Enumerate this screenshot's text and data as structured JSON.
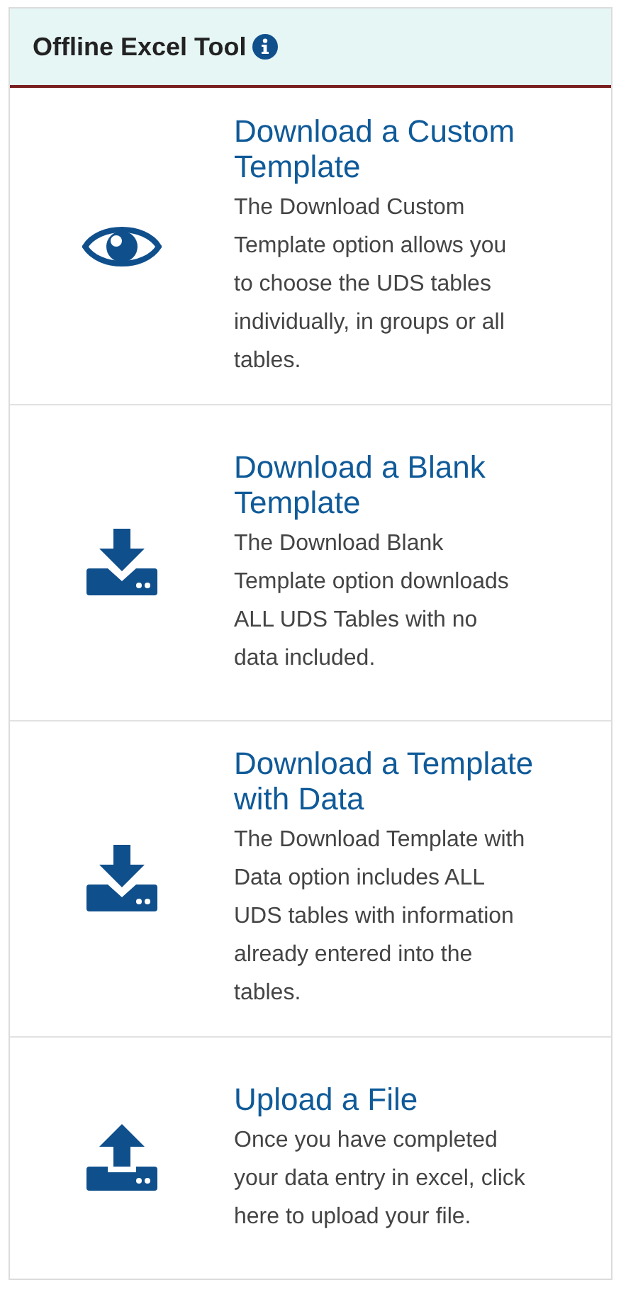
{
  "panel": {
    "title": "Offline Excel Tool"
  },
  "options": [
    {
      "kind": "eye",
      "title": "Download a Custom Template",
      "description": "The Download Custom Template option allows you to choose the UDS tables individually, in groups or all tables."
    },
    {
      "kind": "download",
      "title": "Download a Blank Template",
      "description": "The Download Blank Template option downloads ALL UDS Tables with no data included."
    },
    {
      "kind": "download",
      "title": "Download a Template with Data",
      "description": "The Download Template with Data option includes ALL UDS tables with information already entered into the tables."
    },
    {
      "kind": "upload",
      "title": "Upload a File",
      "description": "Once you have completed your data entry in excel, click here to upload your file."
    }
  ]
}
